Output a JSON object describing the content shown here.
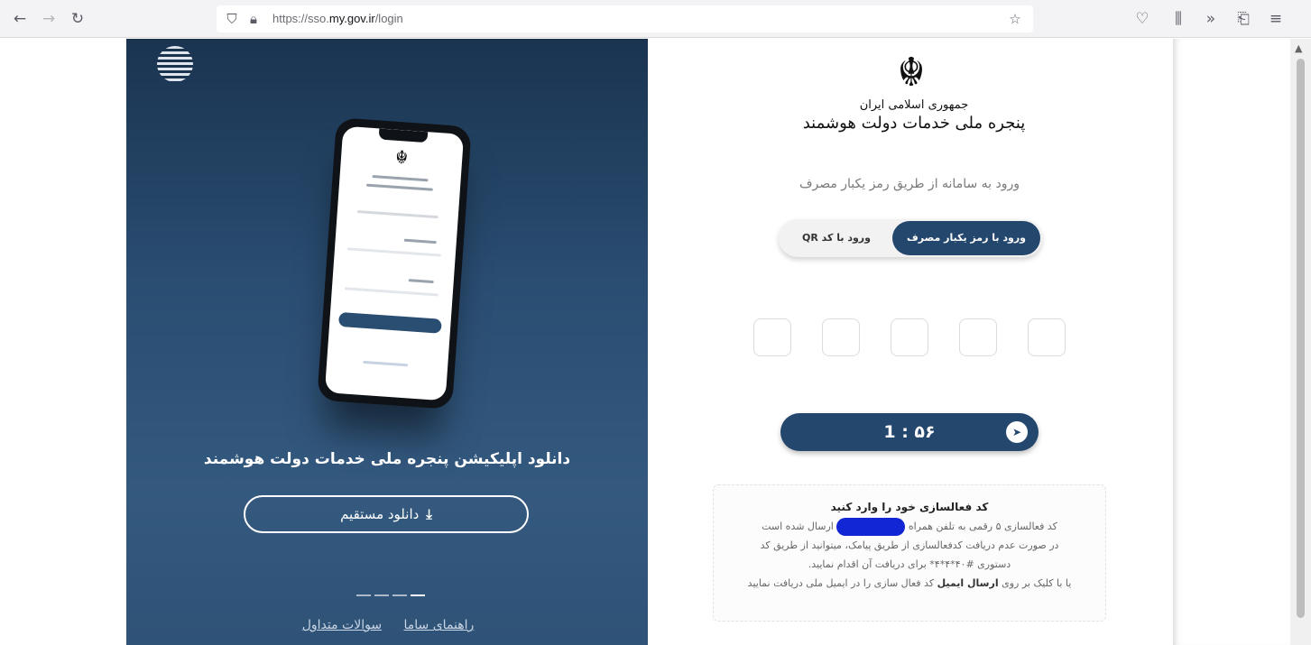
{
  "browser": {
    "url_prefix": "https://sso.",
    "url_domain": "my.gov.ir",
    "url_path": "/login",
    "icons": {
      "back": "back-arrow-icon",
      "forward": "forward-arrow-icon",
      "reload": "reload-icon",
      "shield": "tracking-shield-icon",
      "lock": "lock-icon",
      "star": "bookmark-star-icon",
      "pocket": "pocket-icon",
      "library": "library-icon",
      "overflow": "overflow-chevron-icon",
      "extensions": "extensions-icon",
      "menu": "menu-icon"
    }
  },
  "left_panel": {
    "title": "دانلود اپلیکیشن پنجره ملی خدمات دولت هوشمند",
    "download_label": "دانلود مستقیم",
    "links": [
      "راهنمای ساما",
      "سوالات متداول"
    ],
    "accent_color": "#24476e"
  },
  "right_panel": {
    "emblem_line1": "جمهوری اسلامی ایران",
    "emblem_line2": "پنجره ملی خدمات دولت هوشمند",
    "subtitle": "ورود به سامانه از طریق رمز یکبار مصرف",
    "toggle_active": "ورود با رمز یکبار مصرف",
    "toggle_inactive": "ورود با کد QR",
    "otp_boxes": 5,
    "timer": "1 : ۵۶",
    "info": {
      "title": "کد فعالسازی خود را وارد کنید",
      "line1_a": "کد فعالسازی ۵ رقمی به تلفن همراه",
      "line1_b": "ارسال شده است",
      "line2": "در صورت عدم دریافت کدفعالسازی از طریق پیامک، میتوانید از طریق کد",
      "line3": "دستوری #۴۰*۴*۴* برای دریافت آن اقدام نمایید.",
      "line4_a": "یا با کلیک بر روی",
      "line4_bold": "ارسال ایمیل",
      "line4_b": "کد فعال سازی را در ایمیل ملی دریافت نمایید"
    }
  }
}
